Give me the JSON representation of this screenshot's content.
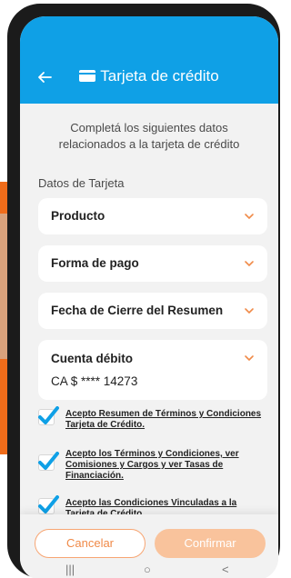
{
  "header": {
    "title": "Tarjeta de crédito",
    "back_icon": "arrow-left-icon",
    "title_icon": "credit-card-icon",
    "color": "#0fa0e6"
  },
  "intro": {
    "line1": "Completá los siguientes datos",
    "line2": "relacionados a la tarjeta de crédito"
  },
  "section": {
    "label": "Datos de Tarjeta"
  },
  "fields": [
    {
      "label": "Producto",
      "icon": "chevron-down-icon"
    },
    {
      "label": "Forma de pago",
      "icon": "chevron-down-icon"
    },
    {
      "label": "Fecha de Cierre del Resumen",
      "icon": "chevron-down-icon"
    },
    {
      "label": "Cuenta débito",
      "value": "CA $ **** 14273",
      "icon": "chevron-down-icon"
    }
  ],
  "checks": [
    {
      "line1": "Acepto Resumen de Términos y Condiciones",
      "line2": "Tarjeta de Crédito.",
      "checked": true
    },
    {
      "line1": "Acepto los Términos y Condiciones, ver",
      "line2": "Comisiones y Cargos y ver Tasas de",
      "line3": "Financiación.",
      "checked": true
    },
    {
      "line1": "Acepto las Condiciones Vinculadas a la",
      "line2": "Tarjeta de Crédito",
      "checked": true
    }
  ],
  "actions": {
    "cancel": "Cancelar",
    "confirm": "Confirmar"
  },
  "navbar": {
    "recents": "|||",
    "home": "○",
    "back": "<"
  },
  "colors": {
    "accent": "#f08a48",
    "check": "#0fa0e6"
  }
}
